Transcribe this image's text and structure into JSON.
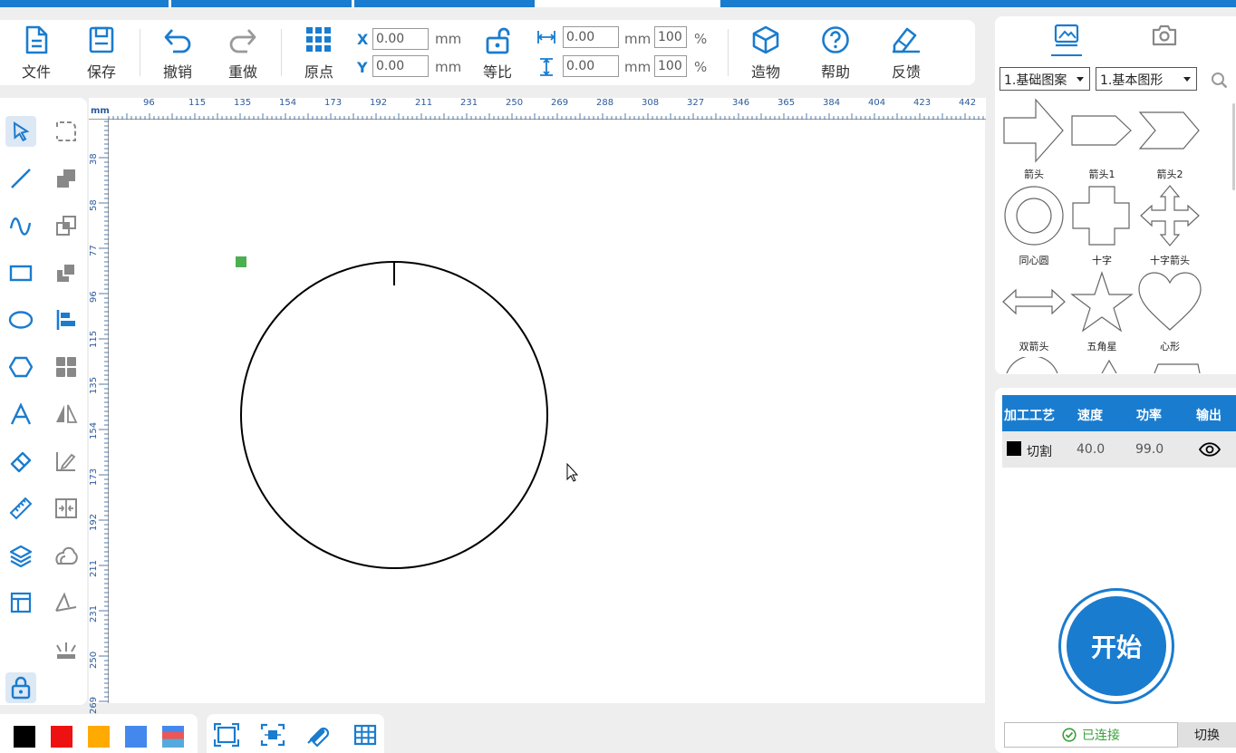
{
  "toolbar": {
    "file": "文件",
    "save": "保存",
    "undo": "撤销",
    "redo": "重做",
    "origin": "原点",
    "x_label": "X",
    "y_label": "Y",
    "x_value": "0.00",
    "y_value": "0.00",
    "unit": "mm",
    "ratio": "等比",
    "width_value": "0.00",
    "height_value": "0.00",
    "width_pct": "100",
    "height_pct": "100",
    "pct": "%",
    "make": "造物",
    "help": "帮助",
    "feedback": "反馈"
  },
  "ruler": {
    "unit": "mm",
    "top_labels": [
      "96",
      "115",
      "135",
      "154",
      "173",
      "192",
      "211",
      "231",
      "250",
      "269",
      "288",
      "308",
      "327",
      "346",
      "365",
      "384",
      "404",
      "423",
      "442"
    ],
    "left_labels": [
      "38",
      "58",
      "77",
      "96",
      "115",
      "135",
      "154",
      "173",
      "192",
      "211",
      "231",
      "250",
      "269"
    ]
  },
  "library": {
    "category": "1.基础图案",
    "subcategory": "1.基本图形",
    "shapes": [
      {
        "name": "箭头"
      },
      {
        "name": "箭头1"
      },
      {
        "name": "箭头2"
      },
      {
        "name": "同心圆"
      },
      {
        "name": "十字"
      },
      {
        "name": "十字箭头"
      },
      {
        "name": "双箭头"
      },
      {
        "name": "五角星"
      },
      {
        "name": "心形"
      }
    ]
  },
  "process": {
    "headers": [
      "加工工艺",
      "速度",
      "功率",
      "输出"
    ],
    "rows": [
      {
        "color": "#000000",
        "name": "切割",
        "speed": "40.0",
        "power": "99.0"
      }
    ]
  },
  "start_label": "开始",
  "status": {
    "connected": "已连接",
    "switch": "切换"
  },
  "palette": [
    "#000000",
    "#ee1111",
    "#ffaa00",
    "#4488ee"
  ],
  "colors": {
    "accent": "#1a7ccf",
    "selection_handle": "#4caf50"
  }
}
